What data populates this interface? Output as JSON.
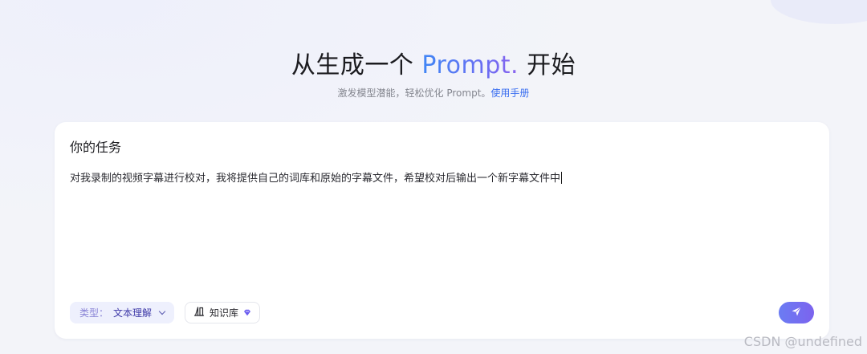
{
  "hero": {
    "title_prefix": "从生成一个 ",
    "title_accent": "Prompt.",
    "title_suffix": " 开始",
    "subtitle_text": "激发模型潜能，轻松优化 Prompt。",
    "subtitle_link": "使用手册"
  },
  "task": {
    "title": "你的任务",
    "input_value": "对我录制的视频字幕进行校对，我将提供自己的词库和原始的字幕文件，希望校对后输出一个新字幕文件中"
  },
  "toolbar": {
    "type_label": "类型：",
    "type_value": "文本理解",
    "knowledge_label": "知识库"
  },
  "watermark": "CSDN @undefined",
  "colors": {
    "accent_blue": "#3f86f5",
    "accent_purple": "#7c63ee",
    "link": "#3b6ff0",
    "chip_bg": "#eef0fd"
  },
  "icons": {
    "knowledge": "books-icon",
    "badge": "diamond-icon",
    "send": "paper-plane-icon",
    "dropdown": "chevron-down-icon"
  }
}
